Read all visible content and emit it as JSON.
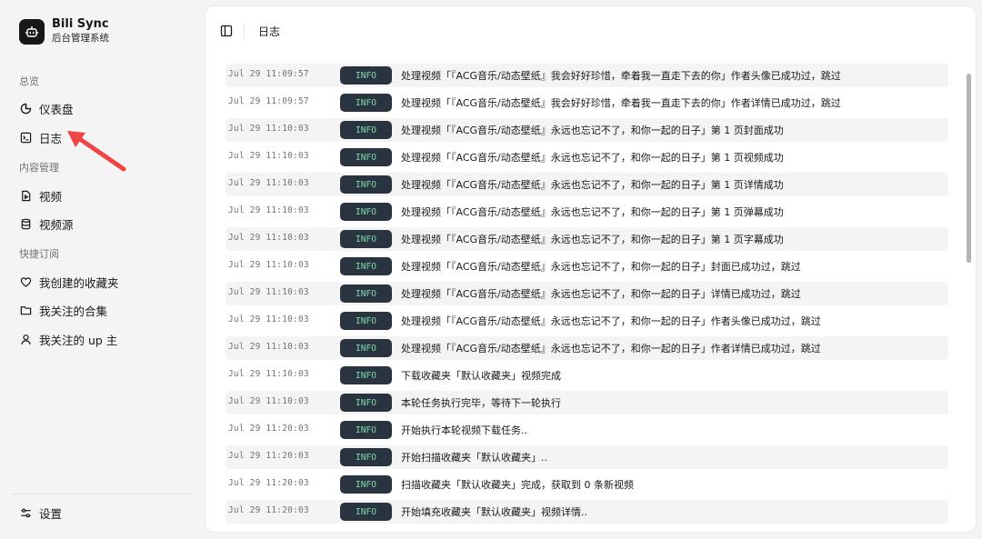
{
  "brand": {
    "title": "Bili Sync",
    "subtitle": "后台管理系统"
  },
  "sidebar": {
    "overview_label": "总览",
    "dashboard": "仪表盘",
    "logs": "日志",
    "content_label": "内容管理",
    "videos": "视频",
    "video_sources": "视频源",
    "subscribe_label": "快捷订阅",
    "my_favorites": "我创建的收藏夹",
    "my_collections": "我关注的合集",
    "my_ups": "我关注的 up 主",
    "settings": "设置"
  },
  "header": {
    "title": "日志"
  },
  "colors": {
    "badge_bg": "#2a3440",
    "badge_text": "#7ddcaa",
    "arrow": "#ef4444"
  },
  "logs": [
    {
      "time": "Jul 29 11:09:57",
      "level": "INFO",
      "message": "处理视频「『ACG音乐/动态壁纸』我会好好珍惜，牵着我一直走下去的你」作者头像已成功过，跳过"
    },
    {
      "time": "Jul 29 11:09:57",
      "level": "INFO",
      "message": "处理视频「『ACG音乐/动态壁纸』我会好好珍惜，牵着我一直走下去的你」作者详情已成功过，跳过"
    },
    {
      "time": "Jul 29 11:10:03",
      "level": "INFO",
      "message": "处理视频「『ACG音乐/动态壁纸』永远也忘记不了，和你一起的日子」第 1 页封面成功"
    },
    {
      "time": "Jul 29 11:10:03",
      "level": "INFO",
      "message": "处理视频「『ACG音乐/动态壁纸』永远也忘记不了，和你一起的日子」第 1 页视频成功"
    },
    {
      "time": "Jul 29 11:10:03",
      "level": "INFO",
      "message": "处理视频「『ACG音乐/动态壁纸』永远也忘记不了，和你一起的日子」第 1 页详情成功"
    },
    {
      "time": "Jul 29 11:10:03",
      "level": "INFO",
      "message": "处理视频「『ACG音乐/动态壁纸』永远也忘记不了，和你一起的日子」第 1 页弹幕成功"
    },
    {
      "time": "Jul 29 11:10:03",
      "level": "INFO",
      "message": "处理视频「『ACG音乐/动态壁纸』永远也忘记不了，和你一起的日子」第 1 页字幕成功"
    },
    {
      "time": "Jul 29 11:10:03",
      "level": "INFO",
      "message": "处理视频「『ACG音乐/动态壁纸』永远也忘记不了，和你一起的日子」封面已成功过，跳过"
    },
    {
      "time": "Jul 29 11:10:03",
      "level": "INFO",
      "message": "处理视频「『ACG音乐/动态壁纸』永远也忘记不了，和你一起的日子」详情已成功过，跳过"
    },
    {
      "time": "Jul 29 11:10:03",
      "level": "INFO",
      "message": "处理视频「『ACG音乐/动态壁纸』永远也忘记不了，和你一起的日子」作者头像已成功过，跳过"
    },
    {
      "time": "Jul 29 11:10:03",
      "level": "INFO",
      "message": "处理视频「『ACG音乐/动态壁纸』永远也忘记不了，和你一起的日子」作者详情已成功过，跳过"
    },
    {
      "time": "Jul 29 11:10:03",
      "level": "INFO",
      "message": "下载收藏夹「默认收藏夹」视频完成"
    },
    {
      "time": "Jul 29 11:10:03",
      "level": "INFO",
      "message": "本轮任务执行完毕，等待下一轮执行"
    },
    {
      "time": "Jul 29 11:20:03",
      "level": "INFO",
      "message": "开始执行本轮视频下载任务.."
    },
    {
      "time": "Jul 29 11:20:03",
      "level": "INFO",
      "message": "开始扫描收藏夹「默认收藏夹」.."
    },
    {
      "time": "Jul 29 11:20:03",
      "level": "INFO",
      "message": "扫描收藏夹「默认收藏夹」完成，获取到 0 条新视频"
    },
    {
      "time": "Jul 29 11:20:03",
      "level": "INFO",
      "message": "开始填充收藏夹「默认收藏夹」视频详情.."
    }
  ]
}
